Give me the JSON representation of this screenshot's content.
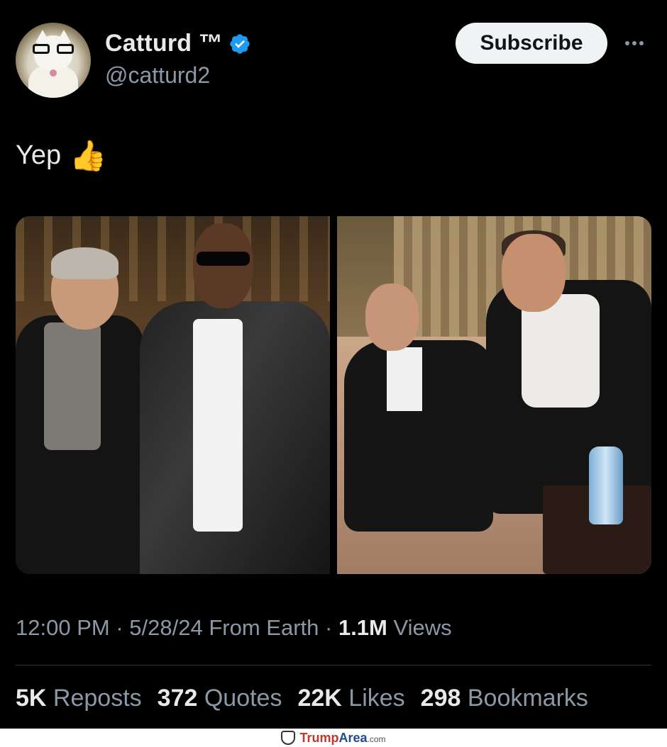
{
  "author": {
    "display_name": "Catturd ™",
    "handle": "@catturd2",
    "verified": true,
    "avatar_icon": "cat-with-glasses-avatar"
  },
  "actions": {
    "subscribe_label": "Subscribe",
    "more_icon": "more-horizontal-icon"
  },
  "tweet": {
    "text": "Yep",
    "emoji": "👍"
  },
  "media": {
    "count": 2
  },
  "meta": {
    "time": "12:00 PM",
    "separator": "·",
    "date": "5/28/24",
    "source": "From Earth",
    "views_count": "1.1M",
    "views_label": "Views"
  },
  "stats": [
    {
      "count": "5K",
      "label": "Reposts"
    },
    {
      "count": "372",
      "label": "Quotes"
    },
    {
      "count": "22K",
      "label": "Likes"
    },
    {
      "count": "298",
      "label": "Bookmarks"
    }
  ],
  "footer": {
    "brand_a": "Trump",
    "brand_b": "Area",
    "brand_c": ".com"
  },
  "colors": {
    "background": "#000000",
    "text_primary": "#e7e9ea",
    "text_secondary": "#8b98a5",
    "verified_blue": "#1d9bf0",
    "divider": "#2f3336"
  }
}
